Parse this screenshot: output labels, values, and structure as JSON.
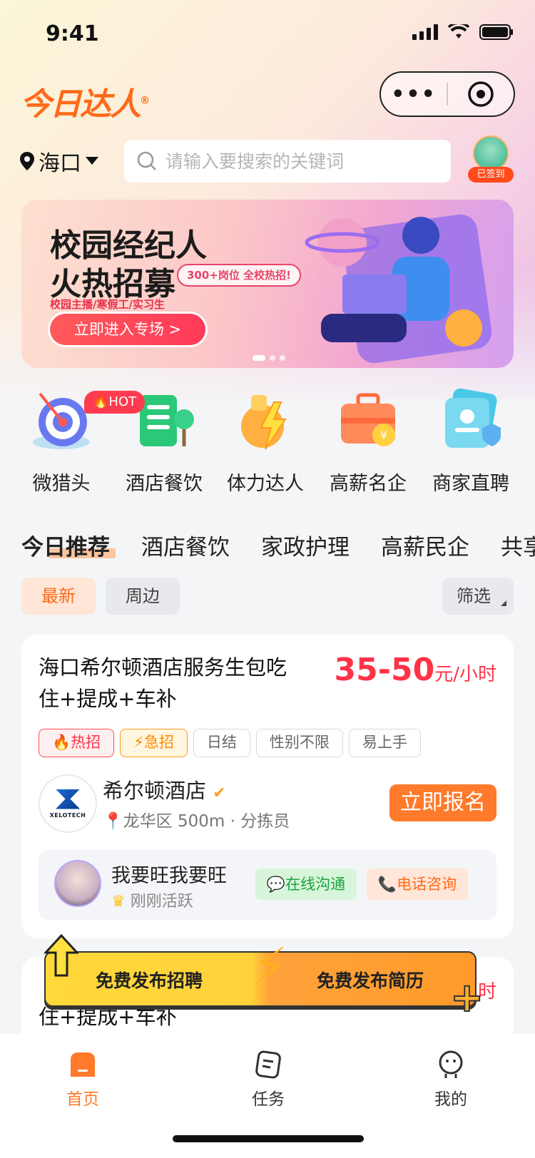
{
  "status_bar": {
    "time": "9:41"
  },
  "header": {
    "logo_text": "今日达人",
    "logo_mark": "®"
  },
  "location": {
    "city": "海口"
  },
  "search": {
    "placeholder": "请输入要搜索的关键词"
  },
  "checkin": {
    "label": "已签到"
  },
  "banner": {
    "title_line1": "校园经纪人",
    "title_line2": "火热招募",
    "pill": "300+岗位 全校热招!",
    "subtitle": "校园主播/寒假工/实习生",
    "cta": "立即进入专场 >",
    "page_count": 3,
    "current_page": 1
  },
  "categories": [
    {
      "label": "微猎头",
      "icon": "target-icon"
    },
    {
      "label": "酒店餐饮",
      "icon": "hotel-icon"
    },
    {
      "label": "体力达人",
      "icon": "lightning-fist-icon"
    },
    {
      "label": "高薪名企",
      "icon": "briefcase-icon"
    },
    {
      "label": "商家直聘",
      "icon": "id-card-icon"
    }
  ],
  "hot_badge": "HOT",
  "tabs": [
    "今日推荐",
    "酒店餐饮",
    "家政护理",
    "高薪民企",
    "共享"
  ],
  "filters": {
    "newest": "最新",
    "nearby": "周边",
    "filter": "筛选"
  },
  "job_card": {
    "title": "海口希尔顿酒店服务生包吃住+提成+车补",
    "salary_range": "35-50",
    "salary_unit": "元/小时",
    "tags": [
      "热招",
      "急招",
      "日结",
      "性别不限",
      "易上手"
    ],
    "company_name": "希尔顿酒店",
    "company_logo_text": "XELOTECH",
    "district": "龙华区 500m · 分拣员",
    "apply": "立即报名",
    "recruiter_name": "我要旺我要旺",
    "recruiter_status": "刚刚活跃",
    "chat": "在线沟通",
    "call": "电话咨询"
  },
  "job_card2": {
    "title": "住+提成+车补",
    "salary_unit": "时"
  },
  "publish_bar": {
    "left": "免费发布招聘",
    "right": "免费发布简历"
  },
  "nav": [
    {
      "label": "首页",
      "icon": "home-icon",
      "active": true
    },
    {
      "label": "任务",
      "icon": "task-icon",
      "active": false
    },
    {
      "label": "我的",
      "icon": "profile-icon",
      "active": false
    }
  ],
  "colors": {
    "accent": "#ff7a2a",
    "price": "#ff3347",
    "chat": "#1aa33a"
  }
}
